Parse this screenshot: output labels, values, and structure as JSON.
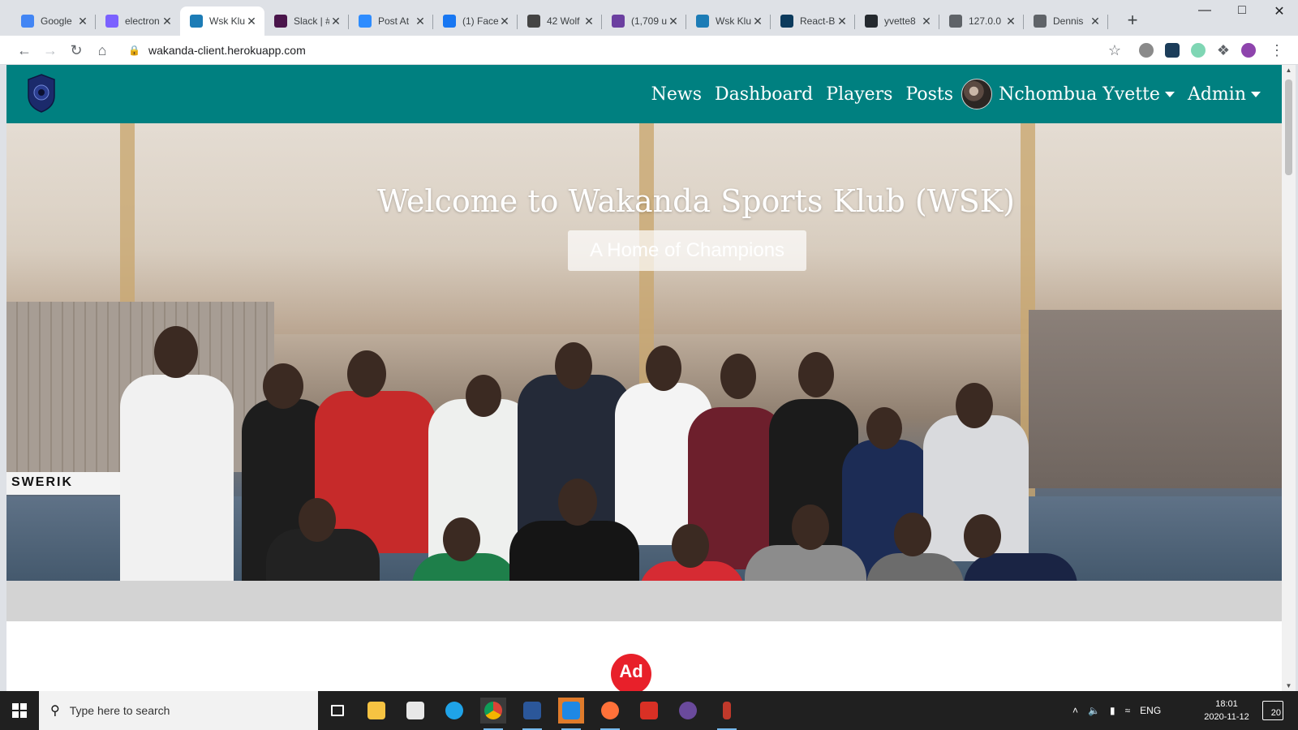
{
  "browser": {
    "tabs": [
      {
        "title": "Google",
        "favicon": "google-icon",
        "color": "#4285f4"
      },
      {
        "title": "electron",
        "favicon": "hashnode-icon",
        "color": "#7b61ff"
      },
      {
        "title": "Wsk Klub",
        "favicon": "react-icon",
        "color": "#1c7cb6",
        "active": true
      },
      {
        "title": "Slack | #",
        "favicon": "slack-icon",
        "color": "#4a154b"
      },
      {
        "title": "Post At",
        "favicon": "zoom-icon",
        "color": "#2d8cff"
      },
      {
        "title": "(1) Face",
        "favicon": "facebook-icon",
        "color": "#1877f2"
      },
      {
        "title": "42 Wolf",
        "favicon": "people-icon",
        "color": "#444444"
      },
      {
        "title": "(1,709 u",
        "favicon": "mail-icon",
        "color": "#6b3fa0"
      },
      {
        "title": "Wsk Klub",
        "favicon": "react-icon",
        "color": "#1c7cb6"
      },
      {
        "title": "React-B",
        "favicon": "react-icon",
        "color": "#0b3a5c"
      },
      {
        "title": "yvette8",
        "favicon": "github-icon",
        "color": "#24292e"
      },
      {
        "title": "127.0.0",
        "favicon": "globe-icon",
        "color": "#5f6368"
      },
      {
        "title": "Dennis",
        "favicon": "globe-icon",
        "color": "#5f6368"
      }
    ],
    "new_tab": "+",
    "url": "wakanda-client.herokuapp.com"
  },
  "site": {
    "nav": {
      "news": "News",
      "dashboard": "Dashboard",
      "players": "Players",
      "posts": "Posts",
      "user": "Nchombua Yvette",
      "admin": "Admin"
    },
    "hero": {
      "title": "Welcome to Wakanda Sports Klub (WSK)",
      "badge": "A Home of Champions",
      "banner_text": "SWERIK"
    },
    "ad_label": "Ad",
    "brand_color": "#008080"
  },
  "taskbar": {
    "search_placeholder": "Type here to search",
    "language": "ENG",
    "time": "18:01",
    "date": "2020-11-12",
    "notifications": "20"
  }
}
